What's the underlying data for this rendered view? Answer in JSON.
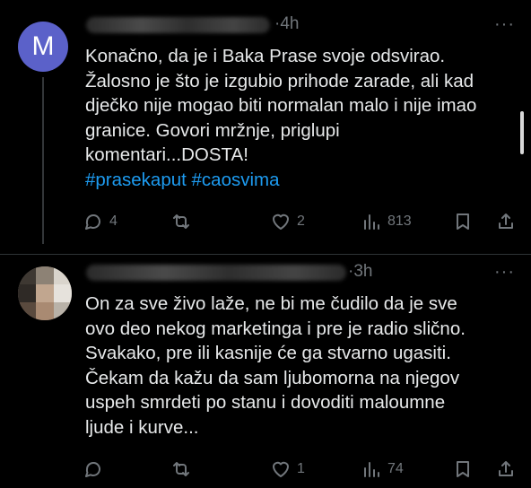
{
  "tweets": [
    {
      "avatar_letter": "M",
      "time": "·4h",
      "more": "···",
      "lines": [
        "Konačno, da je i Baka Prase svoje odsvirao.",
        "Žalosno je što je izgubio prihode zarade, ali kad",
        "dječko nije mogao biti normalan malo i nije imao",
        "granice. Govori mržnje, priglupi",
        "komentari...DOSTA!"
      ],
      "hashtags": "#prasekaput #caosvima",
      "replies": "4",
      "retweets": "",
      "likes": "2",
      "views": "813"
    },
    {
      "time": "·3h",
      "more": "···",
      "lines": [
        "On za sve živo laže, ne bi me čudilo da je sve",
        "ovo deo nekog marketinga i pre je radio slično.",
        "Svakako, pre ili kasnije će ga stvarno ugasiti.",
        "Čekam da kažu da sam ljubomorna na njegov",
        "uspeh smrdeti po stanu i dovoditi maloumne",
        "ljude i kurve..."
      ],
      "replies": "",
      "retweets": "",
      "likes": "1",
      "views": "74"
    }
  ],
  "icons": {
    "reply": "reply-icon",
    "retweet": "retweet-icon",
    "like": "heart-icon",
    "views": "views-icon",
    "bookmark": "bookmark-icon",
    "share": "share-icon"
  },
  "colors": {
    "background": "#000000",
    "text": "#e7e9ea",
    "muted": "#71767b",
    "link": "#1d9bf0",
    "avatar": "#5b61c9"
  }
}
